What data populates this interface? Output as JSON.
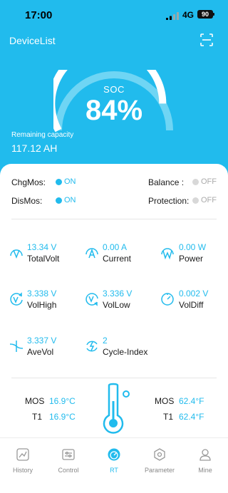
{
  "status": {
    "time": "17:00",
    "network": "4G",
    "battery": "90"
  },
  "header": {
    "title": "DeviceList",
    "soc_label": "SOC",
    "soc_value": "84%",
    "soc_fraction": 0.84,
    "capacity_label": "Remaining capacity",
    "capacity_value": "117.12 AH"
  },
  "mos": {
    "chg_label": "ChgMos:",
    "chg_state": "ON",
    "dis_label": "DisMos:",
    "dis_state": "ON",
    "balance_label": "Balance :",
    "balance_state": "OFF",
    "protection_label": "Protection:",
    "protection_state": "OFF"
  },
  "metrics": [
    {
      "icon": "volt-icon",
      "value": "13.34 V",
      "name": "TotalVolt"
    },
    {
      "icon": "current-icon",
      "value": "0.00 A",
      "name": "Current"
    },
    {
      "icon": "power-icon",
      "value": "0.00 W",
      "name": "Power"
    },
    {
      "icon": "vol-high-icon",
      "value": "3.338 V",
      "name": "VolHigh"
    },
    {
      "icon": "vol-low-icon",
      "value": "3.336 V",
      "name": "VolLow"
    },
    {
      "icon": "vol-diff-icon",
      "value": "0.002 V",
      "name": "VolDiff"
    },
    {
      "icon": "ave-vol-icon",
      "value": "3.337 V",
      "name": "AveVol"
    },
    {
      "icon": "cycle-icon",
      "value": "2",
      "name": "Cycle-Index"
    }
  ],
  "temps": {
    "left": [
      {
        "label": "MOS",
        "value": "16.9°C"
      },
      {
        "label": "T1",
        "value": "16.9°C"
      }
    ],
    "right": [
      {
        "label": "MOS",
        "value": "62.4°F"
      },
      {
        "label": "T1",
        "value": "62.4°F"
      }
    ]
  },
  "tabs": [
    {
      "label": "History",
      "icon": "history-icon",
      "active": false
    },
    {
      "label": "Control",
      "icon": "control-icon",
      "active": false
    },
    {
      "label": "RT",
      "icon": "rt-gauge-icon",
      "active": true
    },
    {
      "label": "Parameter",
      "icon": "parameter-icon",
      "active": false
    },
    {
      "label": "Mine",
      "icon": "user-icon",
      "active": false
    }
  ],
  "colors": {
    "accent": "#21bbed",
    "off": "#d8d8d8"
  }
}
